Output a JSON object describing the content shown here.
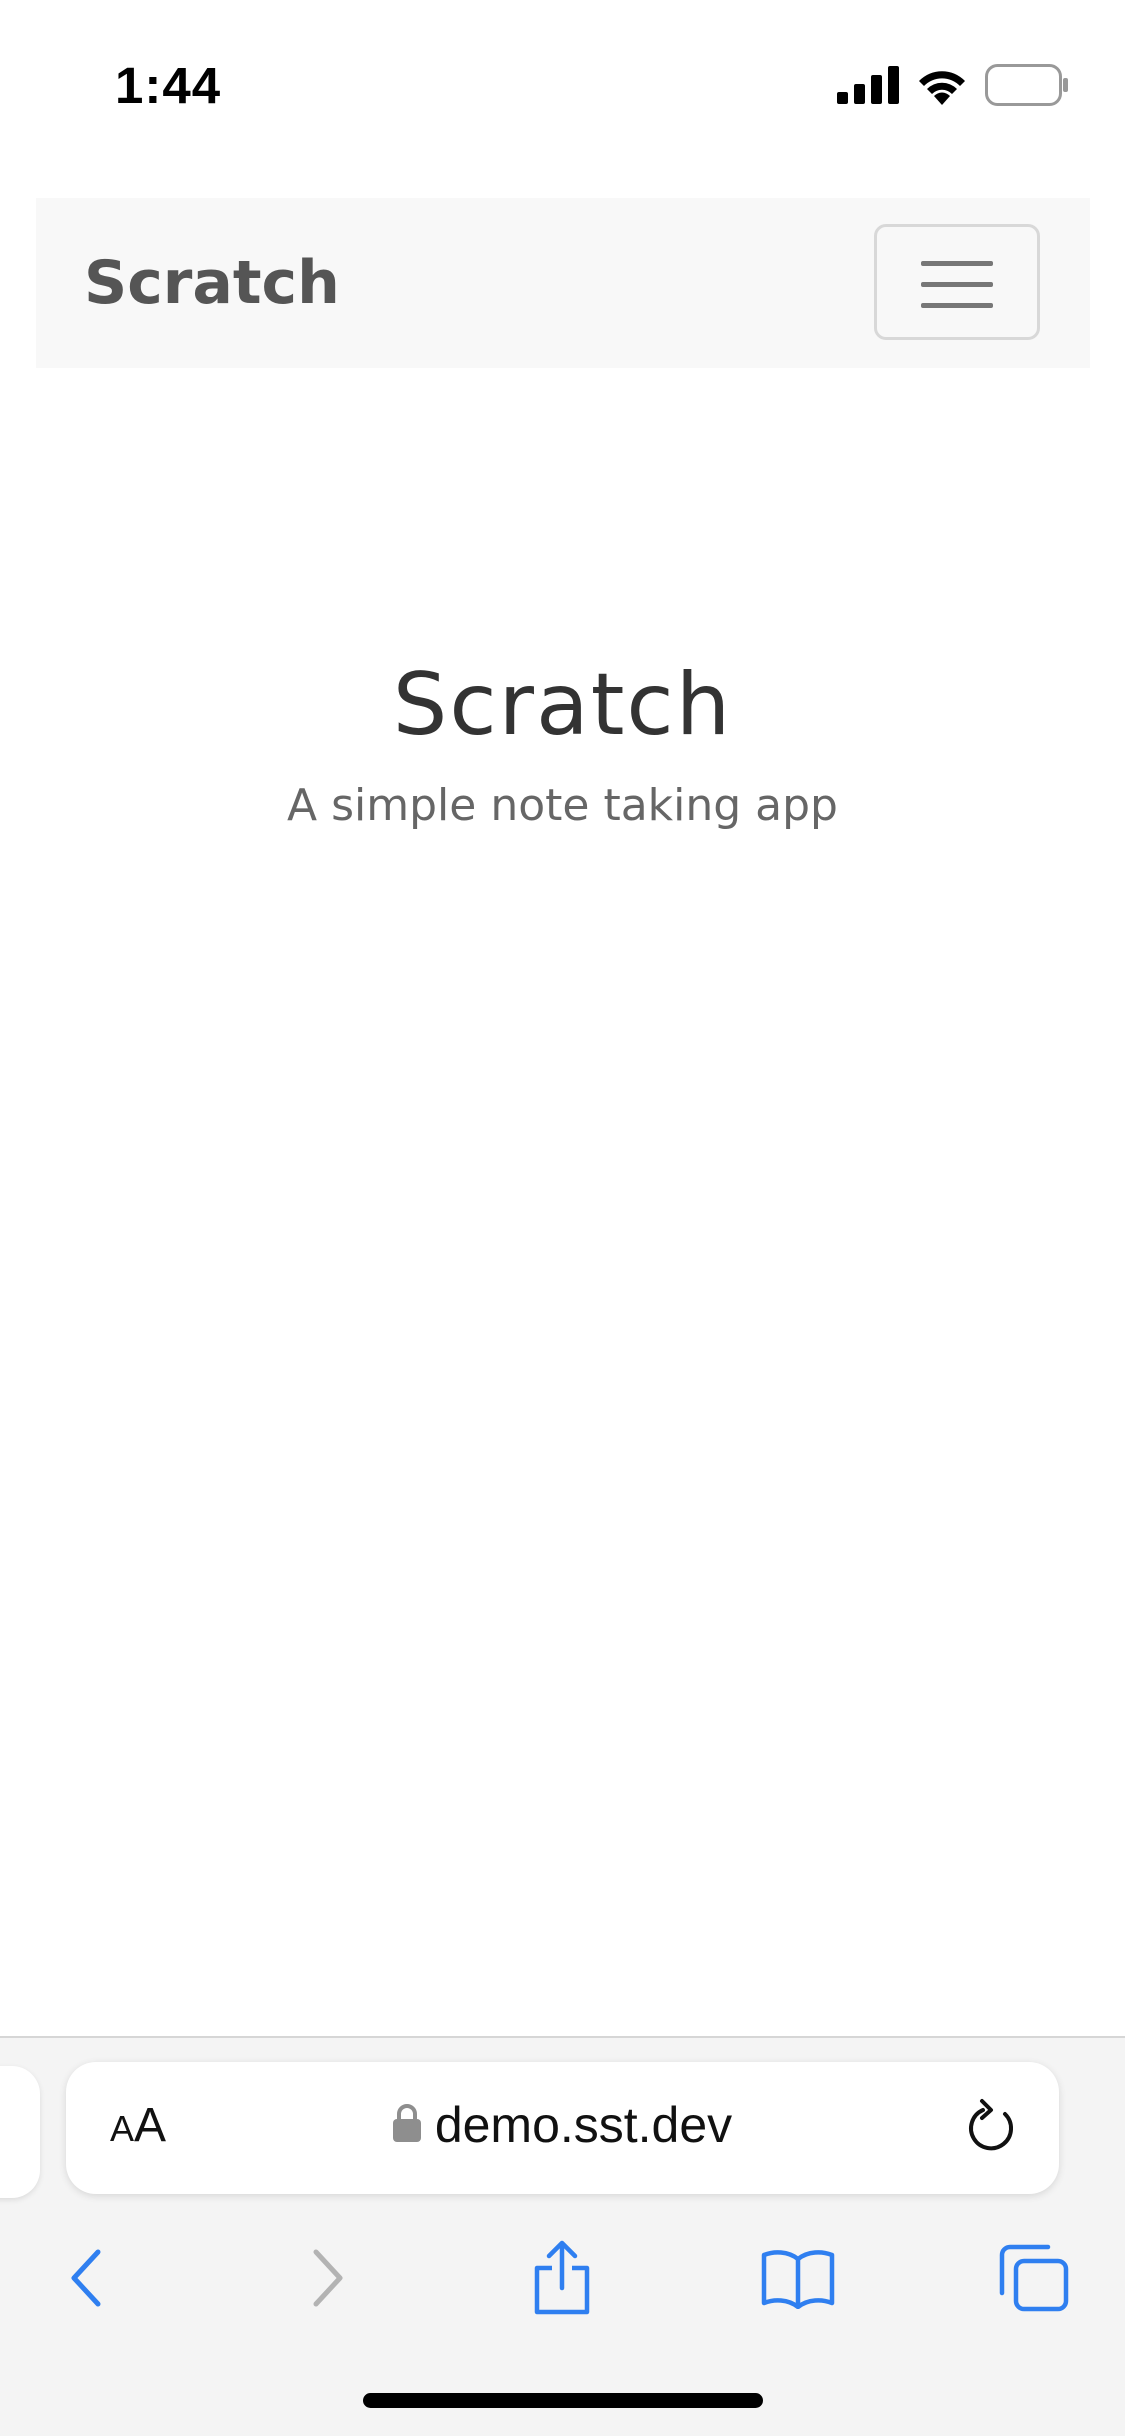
{
  "status_bar": {
    "time": "1:44",
    "icons": [
      "cellular-signal-icon",
      "wifi-icon",
      "battery-icon"
    ]
  },
  "navbar": {
    "brand": "Scratch",
    "toggle_icon": "hamburger-menu-icon",
    "background": "#f8f8f8"
  },
  "hero": {
    "title": "Scratch",
    "subtitle": "A simple note taking app"
  },
  "browser": {
    "text_size_small": "A",
    "text_size_large": "A",
    "url": "demo.sst.dev",
    "secure_icon": "lock-icon",
    "reload_icon": "reload-icon",
    "toolbar": [
      {
        "name": "back-icon",
        "enabled": true
      },
      {
        "name": "forward-icon",
        "enabled": false
      },
      {
        "name": "share-icon",
        "enabled": true
      },
      {
        "name": "bookmarks-icon",
        "enabled": true
      },
      {
        "name": "tabs-icon",
        "enabled": true
      }
    ],
    "accent_color": "#2f7ff0",
    "disabled_color": "#b3b3b3"
  }
}
